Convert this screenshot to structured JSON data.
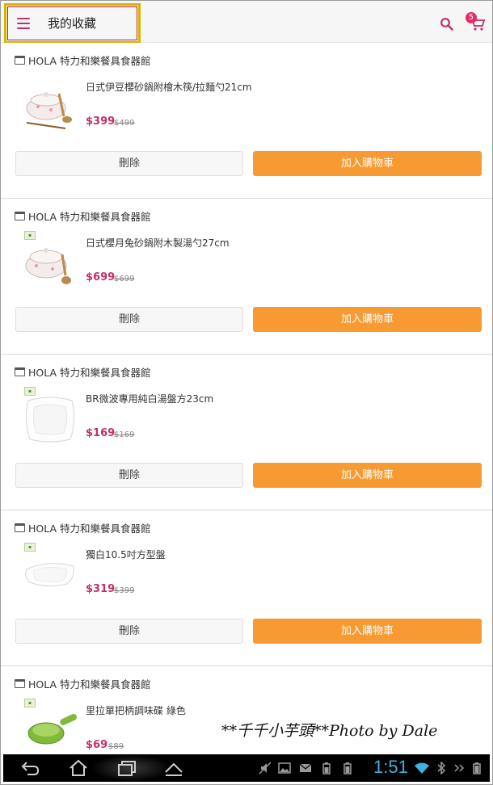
{
  "header": {
    "title": "我的收藏",
    "cart_count": "5",
    "icons": [
      "menu-icon",
      "search-icon",
      "cart-icon"
    ]
  },
  "favorites": [
    {
      "store": "HOLA 特力和樂餐具食器館",
      "name": "日式伊豆櫻砂鍋附檜木筷/拉麵勺21cm",
      "price": "$399",
      "original_price": "$499",
      "delete_label": "刪除",
      "add_label": "加入購物車"
    },
    {
      "store": "HOLA 特力和樂餐具食器館",
      "name": "日式櫻月兔砂鍋附木製湯勺27cm",
      "price": "$699",
      "original_price": "$699",
      "delete_label": "刪除",
      "add_label": "加入購物車"
    },
    {
      "store": "HOLA 特力和樂餐具食器館",
      "name": "BR微波專用純白湯盤方23cm",
      "price": "$169",
      "original_price": "$169",
      "delete_label": "刪除",
      "add_label": "加入購物車"
    },
    {
      "store": "HOLA 特力和樂餐具食器館",
      "name": "獨白10.5吋方型盤",
      "price": "$319",
      "original_price": "$399",
      "delete_label": "刪除",
      "add_label": "加入購物車"
    },
    {
      "store": "HOLA 特力和樂餐具食器館",
      "name": "里拉單把柄調味碟 綠色",
      "price": "$69",
      "original_price": "$89"
    }
  ],
  "watermark": "**千千小芋頭**Photo by Dale",
  "system_bar": {
    "time": "1:51",
    "icons": [
      "back-icon",
      "home-icon",
      "recent-apps-icon",
      "hide-keyboard-icon",
      "mute-icon",
      "image-icon",
      "mail-icon",
      "battery-icon",
      "wifi-icon",
      "bluetooth-icon"
    ]
  },
  "colors": {
    "accent": "#c0306a",
    "add_button": "#f79a32",
    "title_highlight": "#d8b400",
    "clock": "#3fb0e0"
  }
}
